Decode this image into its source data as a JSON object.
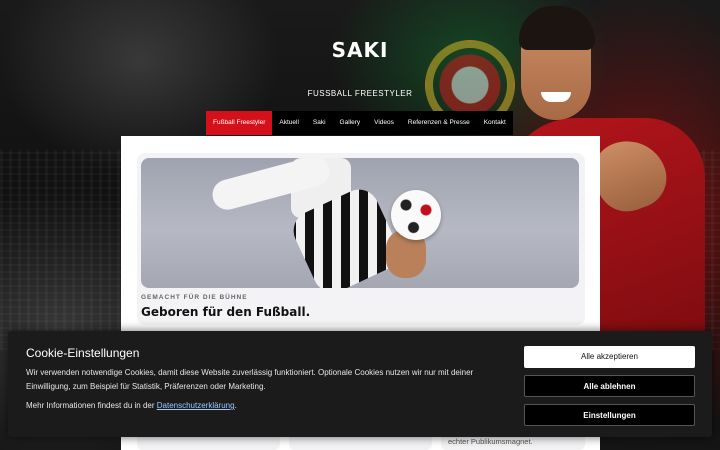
{
  "header": {
    "logo": "SAKI",
    "tagline": "FUSSBALL FREESTYLER"
  },
  "nav": {
    "items": [
      {
        "label": "Fußball Freestyler",
        "active": true
      },
      {
        "label": "Aktuell",
        "active": false
      },
      {
        "label": "Saki",
        "active": false
      },
      {
        "label": "Gallery",
        "active": false
      },
      {
        "label": "Videos",
        "active": false
      },
      {
        "label": "Referenzen & Presse",
        "active": false
      },
      {
        "label": "Kontakt",
        "active": false
      }
    ]
  },
  "feature": {
    "eyebrow": "GEMACHT FÜR DIE BÜHNE",
    "title": "Geboren für den Fußball."
  },
  "peek": {
    "text": "echter Publikumsmagnet."
  },
  "cookie": {
    "title": "Cookie-Einstellungen",
    "text": "Wir verwenden notwendige Cookies, damit diese Website zuverlässig funktioniert. Optionale Cookies nutzen wir nur mit deiner Einwilligung, zum Beispiel für Statistik, Präferenzen oder Marketing.",
    "more_prefix": "Mehr Informationen findest du in der ",
    "more_link": "Datenschutzerklärung",
    "more_suffix": ".",
    "accept_label": "Alle akzeptieren",
    "reject_label": "Alle ablehnen",
    "settings_label": "Einstellungen"
  },
  "colors": {
    "accent": "#d4111b",
    "banner": "#1b1b1b"
  }
}
